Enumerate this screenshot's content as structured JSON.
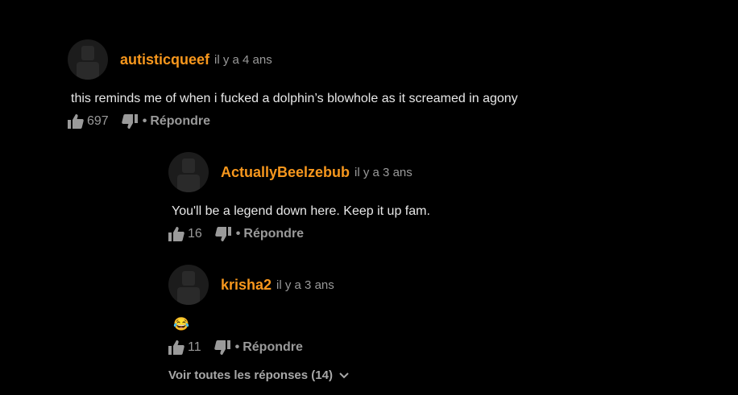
{
  "comments": [
    {
      "username": "autisticqueef",
      "time": "il y a 4 ans",
      "text": "this reminds me of when i fucked a dolphin’s blowhole as it screamed in agony",
      "likes": "697",
      "reply_label": "Répondre"
    },
    {
      "username": "ActuallyBeelzebub",
      "time": "il y a 3 ans",
      "text": "You'll be a legend down here. Keep it up fam.",
      "likes": "16",
      "reply_label": "Répondre"
    },
    {
      "username": "krisha2",
      "time": "il y a 3 ans",
      "text": "😂",
      "likes": "11",
      "reply_label": "Répondre"
    }
  ],
  "separator": "•",
  "view_all_label": "Voir toutes les réponses (14)",
  "colors": {
    "username": "#f7971d",
    "background": "#000000",
    "muted": "#9a9a9a"
  },
  "icons": [
    "avatar-placeholder-icon",
    "thumbs-up-icon",
    "thumbs-down-icon",
    "chevron-down-icon"
  ]
}
